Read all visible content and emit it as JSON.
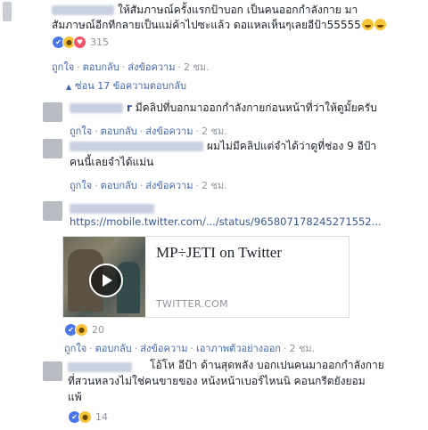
{
  "top_comment": {
    "text_line1": "ให้สัมภาษณ์ครั้งแรกป้าบอก เป็นคนออกกำลังกาย มา",
    "text_line2": "สัมภาษณ์อีกทีกลายเป็นแม่ค้าไปซะแล้ว ดอแหลเห็นๆเลยอีป้า55555",
    "reaction_count": "315",
    "actions": {
      "like": "ถูกใจ",
      "reply": "ตอบกลับ",
      "message": "ส่งข้อความ",
      "time": "2 ชม."
    }
  },
  "replies_toggle": {
    "arrow": "▲",
    "label": "ซ่อน 17 ข้อความตอบกลับ"
  },
  "replies": [
    {
      "text": "มีคลิปที่บอกมาออกกำลังกายก่อนหน้าที่ว่าให้ดูมั้ยครับ",
      "name_suffix": "r",
      "actions": {
        "like": "ถูกใจ",
        "reply": "ตอบกลับ",
        "message": "ส่งข้อความ",
        "time": "2 ชม."
      }
    },
    {
      "text_line1": "ผมไม่มีคลิปแต่จำได้ว่าดูที่ช่อง 9 อีป้า",
      "text_line2": "คนนี้เลยจำได้แม่น",
      "actions": {
        "like": "ถูกใจ",
        "reply": "ตอบกลับ",
        "message": "ส่งข้อความ",
        "time": "2 ชม."
      }
    },
    {
      "url": "https://mobile.twitter.com/.../status/965807178245271552...",
      "preview": {
        "title": "MP÷JETI on Twitter",
        "domain": "TWITTER.COM"
      },
      "reaction_count": "20",
      "actions": {
        "like": "ถูกใจ",
        "reply": "ตอบกลับ",
        "message": "ส่งข้อความ",
        "photo": "เอาภาพตัวอย่างออก",
        "time": "2 ชม."
      }
    },
    {
      "text_line1": "โอ้โห อีป้า ด้านสุดพลัง บอกเปนคนมาออกกำลังกาย",
      "text_line2": "ที่สวนหลวงไม่ใช่คนขายของ หน้งหน้าเบอร์ไหนนิ คอนกรีตยังยอม",
      "text_line3": "แพ้",
      "reaction_count": "14"
    }
  ]
}
